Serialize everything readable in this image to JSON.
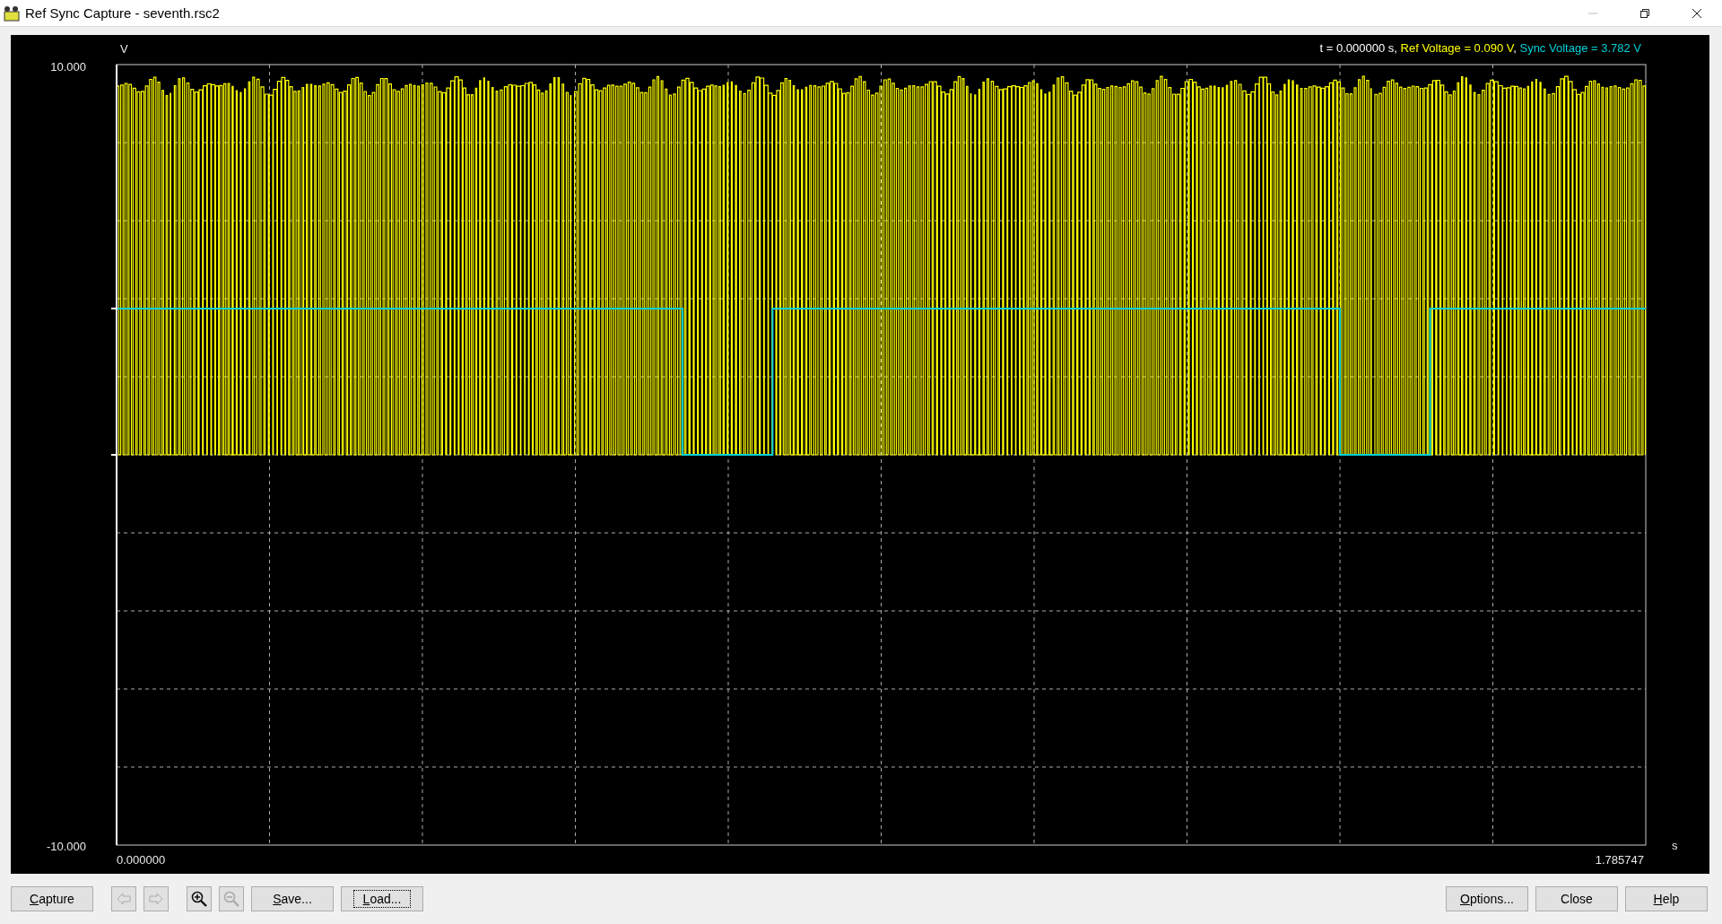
{
  "window": {
    "title": "Ref Sync Capture - seventh.rsc2"
  },
  "plot": {
    "y_unit": "V",
    "y_max_label": "10.000",
    "y_min_label": "-10.000",
    "x_start_label": "0.000000",
    "x_end_label": "1.785747",
    "x_unit": "s",
    "readout": {
      "time": "t = 0.000000 s",
      "separator": ", ",
      "traces": [
        {
          "label": "Ref Voltage =  0.090 V",
          "color": "#ffff00"
        },
        {
          "label": "Sync Voltage =  3.782 V",
          "color": "#00d0d8"
        }
      ]
    }
  },
  "left_buttons": [
    {
      "kind": "text",
      "label": "Capture",
      "mnemonic": true,
      "focused": false,
      "disabled": false
    },
    {
      "kind": "arrow-left",
      "disabled": true
    },
    {
      "kind": "arrow-right",
      "disabled": true
    },
    {
      "kind": "zoom-in",
      "disabled": false
    },
    {
      "kind": "zoom-out",
      "disabled": true
    },
    {
      "kind": "text",
      "label": "Save...",
      "mnemonic": true,
      "focused": false,
      "disabled": false
    },
    {
      "kind": "text",
      "label": "Load...",
      "mnemonic": true,
      "focused": true,
      "disabled": false
    }
  ],
  "right_buttons": [
    {
      "label": "Options...",
      "mnemonic": true
    },
    {
      "label": "Close",
      "mnemonic": false
    },
    {
      "label": "Help",
      "mnemonic": true
    }
  ]
}
